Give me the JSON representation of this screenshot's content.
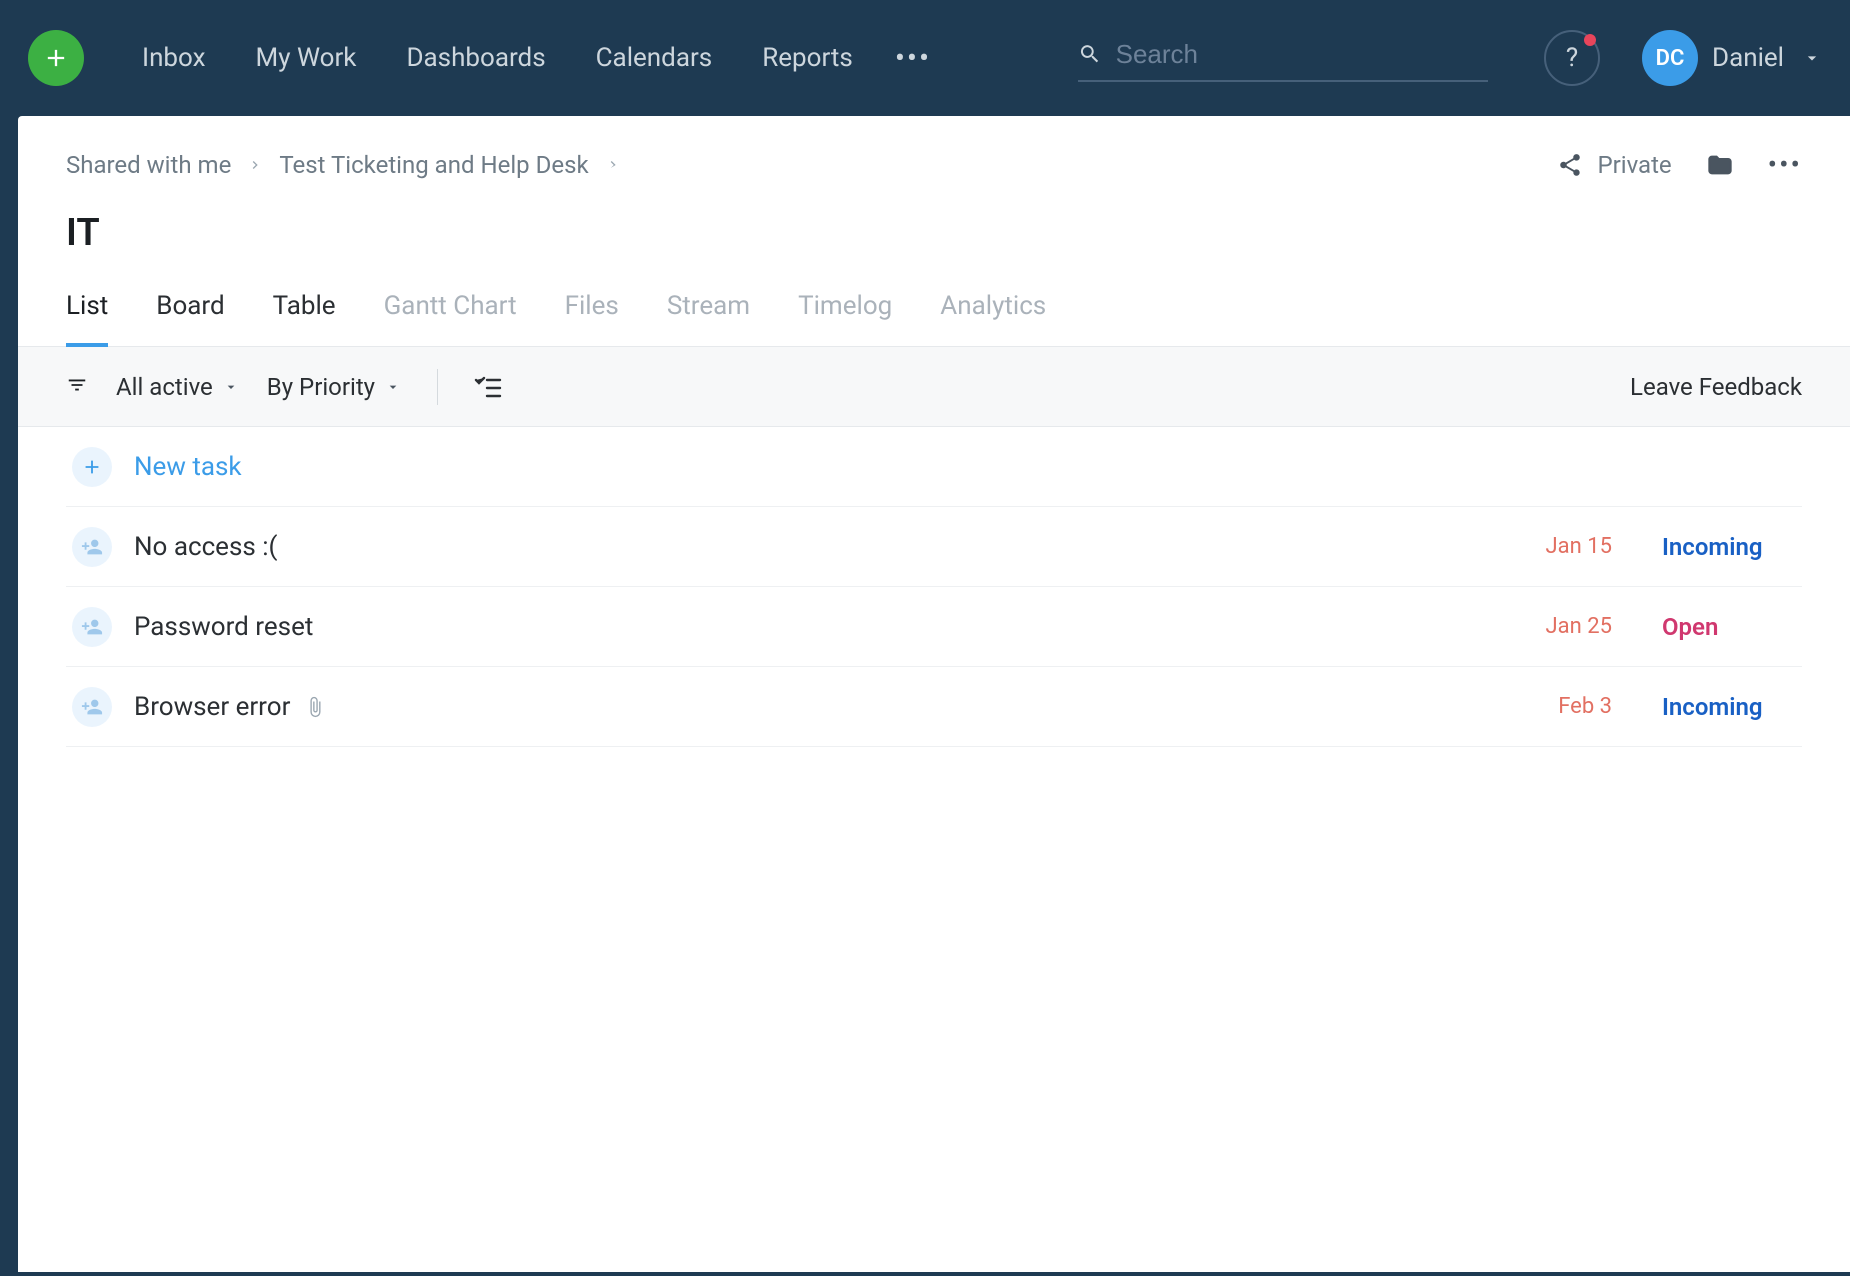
{
  "topbar": {
    "nav": [
      "Inbox",
      "My Work",
      "Dashboards",
      "Calendars",
      "Reports"
    ],
    "search_placeholder": "Search",
    "help_label": "?",
    "user_initials": "DC",
    "user_name": "Daniel"
  },
  "breadcrumb": [
    "Shared with me",
    "Test Ticketing and Help Desk"
  ],
  "share_label": "Private",
  "page_title": "IT",
  "tabs": [
    {
      "label": "List",
      "active": true,
      "dark": true
    },
    {
      "label": "Board",
      "active": false,
      "dark": true
    },
    {
      "label": "Table",
      "active": false,
      "dark": true
    },
    {
      "label": "Gantt Chart",
      "active": false,
      "dark": false
    },
    {
      "label": "Files",
      "active": false,
      "dark": false
    },
    {
      "label": "Stream",
      "active": false,
      "dark": false
    },
    {
      "label": "Timelog",
      "active": false,
      "dark": false
    },
    {
      "label": "Analytics",
      "active": false,
      "dark": false
    }
  ],
  "toolbar": {
    "filter_label": "All active",
    "sort_label": "By Priority",
    "feedback_label": "Leave Feedback"
  },
  "new_task_label": "New task",
  "tasks": [
    {
      "title": "No access :(",
      "date": "Jan 15",
      "status": "Incoming",
      "status_class": "status-incoming",
      "attach": false
    },
    {
      "title": "Password reset",
      "date": "Jan 25",
      "status": "Open",
      "status_class": "status-open",
      "attach": false
    },
    {
      "title": "Browser error",
      "date": "Feb 3",
      "status": "Incoming",
      "status_class": "status-incoming",
      "attach": true
    }
  ]
}
